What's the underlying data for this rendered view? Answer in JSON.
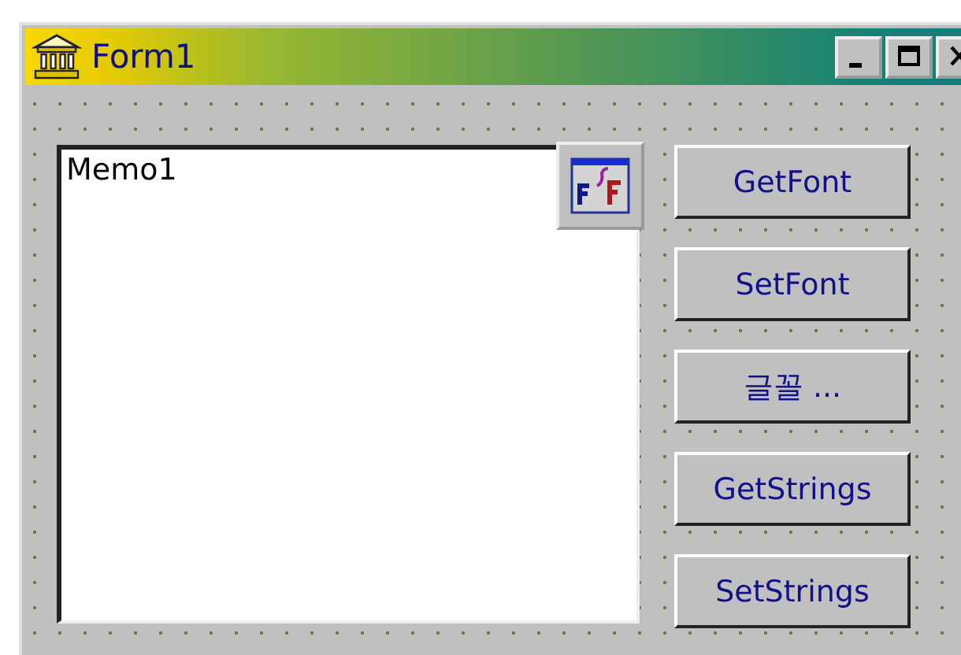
{
  "window": {
    "title": "Form1"
  },
  "memo": {
    "text": "Memo1"
  },
  "buttons": [
    {
      "label": "GetFont"
    },
    {
      "label": "SetFont"
    },
    {
      "label": "글꼴 ..."
    },
    {
      "label": "GetStrings"
    },
    {
      "label": "SetStrings"
    }
  ]
}
